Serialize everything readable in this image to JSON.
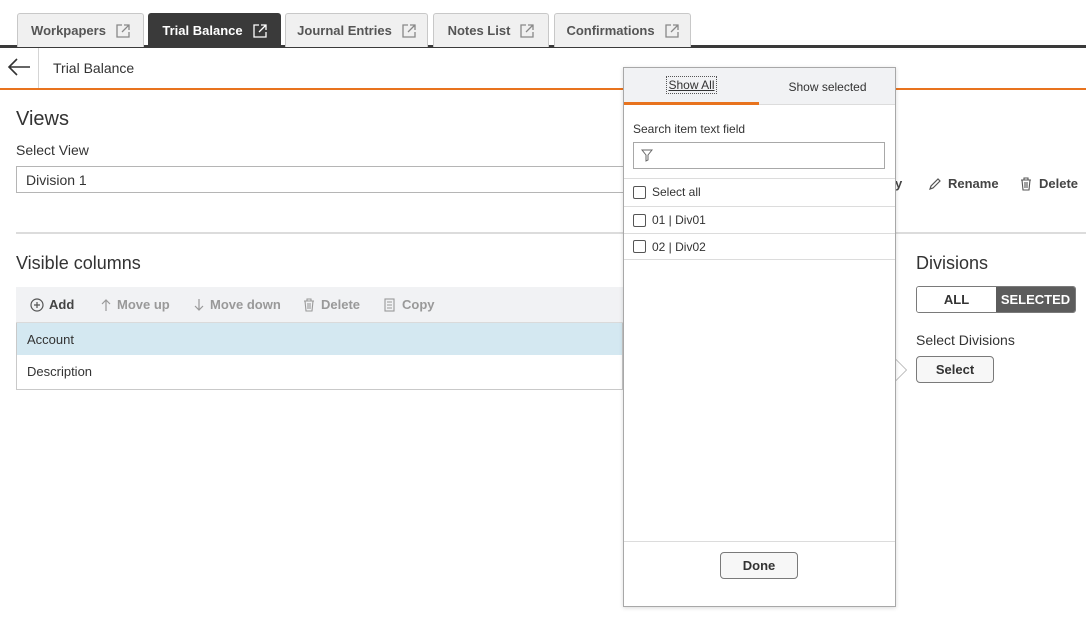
{
  "tabs": [
    {
      "label": "Workpapers",
      "active": false
    },
    {
      "label": "Trial Balance",
      "active": true
    },
    {
      "label": "Journal Entries",
      "active": false
    },
    {
      "label": "Notes List",
      "active": false
    },
    {
      "label": "Confirmations",
      "active": false
    }
  ],
  "page": {
    "title": "Trial Balance"
  },
  "views": {
    "heading": "Views",
    "select_label": "Select View",
    "selected_value": "Division 1",
    "copy_partial": "y",
    "rename_label": "Rename",
    "delete_label": "Delete"
  },
  "columns": {
    "heading": "Visible columns",
    "toolbar": {
      "add": "Add",
      "move_up": "Move up",
      "move_down": "Move down",
      "delete": "Delete",
      "copy": "Copy"
    },
    "rows": [
      "Account",
      "Description"
    ]
  },
  "divisions": {
    "heading": "Divisions",
    "toggle_all": "ALL",
    "toggle_selected": "SELECTED",
    "select_label": "Select Divisions",
    "select_button": "Select"
  },
  "popover": {
    "tab_show_all": "Show All",
    "tab_show_selected": "Show selected",
    "search_label": "Search item text field",
    "search_value": "",
    "select_all": "Select all",
    "items": [
      "01 | Div01",
      "02 | Div02"
    ],
    "done": "Done"
  },
  "colors": {
    "accent": "#e8731e",
    "dark": "#3a3a3a",
    "selected_row": "#d4e8f1"
  }
}
